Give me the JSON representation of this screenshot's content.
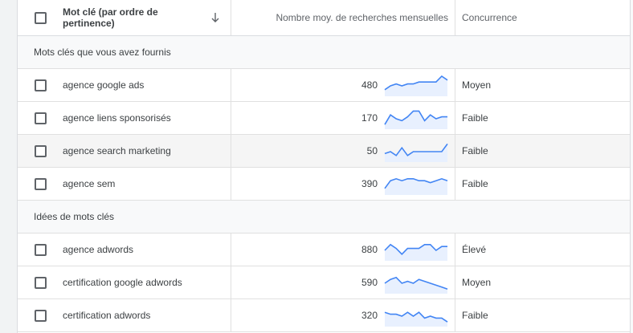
{
  "header": {
    "keyword_col": "Mot clé (par ordre de pertinence)",
    "volume_col": "Nombre moy. de recherches mensuelles",
    "competition_col": "Concurrence"
  },
  "sections": [
    {
      "label": "Mots clés que vous avez fournis",
      "rows": [
        {
          "keyword": "agence google ads",
          "volume": "480",
          "competition": "Moyen",
          "trend": [
            3,
            5,
            6,
            5,
            6,
            6,
            7,
            7,
            7,
            7,
            10,
            8
          ]
        },
        {
          "keyword": "agence liens sponsorisés",
          "volume": "170",
          "competition": "Faible",
          "trend": [
            2,
            7,
            5,
            4,
            6,
            9,
            9,
            4,
            7,
            5,
            6,
            6
          ]
        },
        {
          "keyword": "agence search marketing",
          "volume": "50",
          "competition": "Faible",
          "trend": [
            4,
            5,
            3,
            7,
            3,
            5,
            5,
            5,
            5,
            5,
            5,
            9
          ]
        },
        {
          "keyword": "agence sem",
          "volume": "390",
          "competition": "Faible",
          "trend": [
            3,
            7,
            8,
            7,
            8,
            8,
            7,
            7,
            6,
            7,
            8,
            7
          ]
        }
      ]
    },
    {
      "label": "Idées de mots clés",
      "rows": [
        {
          "keyword": "agence adwords",
          "volume": "880",
          "competition": "Élevé",
          "trend": [
            5,
            8,
            6,
            3,
            6,
            6,
            6,
            8,
            8,
            5,
            7,
            7
          ]
        },
        {
          "keyword": "certification google adwords",
          "volume": "590",
          "competition": "Moyen",
          "trend": [
            5,
            7,
            8,
            5,
            6,
            5,
            7,
            6,
            5,
            4,
            3,
            2
          ]
        },
        {
          "keyword": "certification adwords",
          "volume": "320",
          "competition": "Faible",
          "trend": [
            7,
            6,
            6,
            5,
            7,
            5,
            7,
            4,
            5,
            4,
            4,
            2
          ]
        }
      ]
    }
  ],
  "colors": {
    "accent": "#4285f4",
    "sparkline_fill": "#e8f0fe"
  }
}
